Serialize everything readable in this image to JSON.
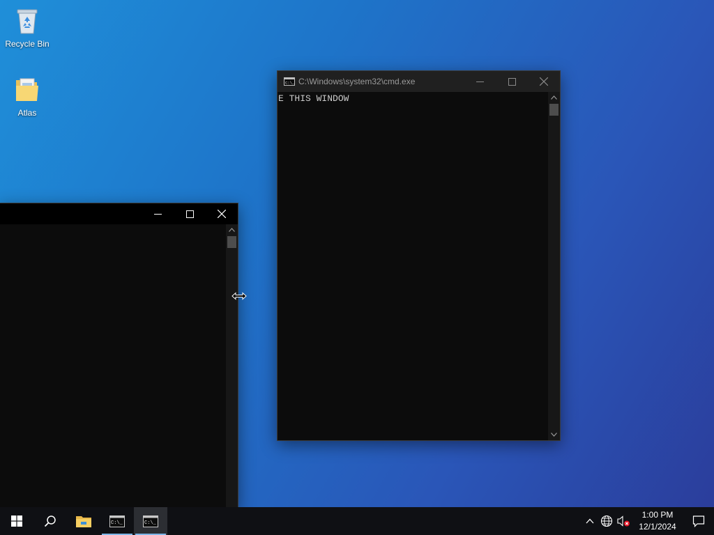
{
  "desktop": {
    "icons": [
      {
        "label": "Recycle Bin",
        "icon": "recycle-bin-icon"
      },
      {
        "label": "Atlas",
        "icon": "folder-icon"
      }
    ]
  },
  "windows": {
    "cmd_right": {
      "title": "C:\\Windows\\system32\\cmd.exe",
      "content": "E THIS WINDOW",
      "buttons": [
        "minimize-icon",
        "maximize-icon",
        "close-icon"
      ]
    },
    "cmd_left": {
      "title": "",
      "content": "",
      "buttons": [
        "minimize-icon",
        "maximize-icon",
        "close-icon"
      ]
    }
  },
  "cursor": {
    "type": "horizontal-resize-cursor-icon"
  },
  "taskbar": {
    "items": [
      {
        "icon": "windows-start-icon"
      },
      {
        "icon": "search-icon"
      },
      {
        "icon": "file-explorer-icon"
      },
      {
        "icon": "command-prompt-icon",
        "running": true
      },
      {
        "icon": "command-prompt-icon",
        "running": true,
        "active": true
      }
    ],
    "tray": {
      "icons": [
        "chevron-up-icon",
        "network-icon",
        "volume-muted-icon"
      ],
      "time": "1:00 PM",
      "date": "12/1/2024",
      "notification_icon": "action-center-icon"
    }
  },
  "colors": {
    "desktop_start": "#1f8fd9",
    "desktop_end": "#2b3c9a",
    "console_bg": "#0c0c0c",
    "taskbar_bg": "#0f1014",
    "taskbar_indicator": "#7eb6e8"
  }
}
